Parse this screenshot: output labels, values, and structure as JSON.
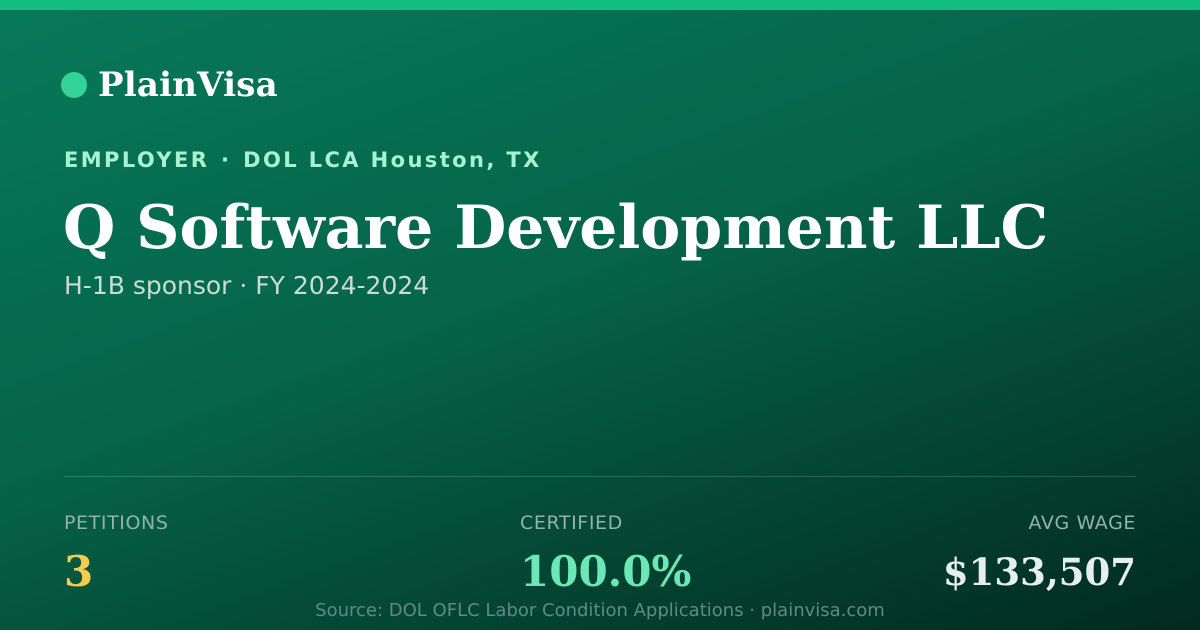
{
  "brand": {
    "name": "PlainVisa",
    "dot_color": "#34d399"
  },
  "header": {
    "eyebrow_category": "EMPLOYER",
    "eyebrow_separator": "·",
    "eyebrow_source": "DOL LCA Houston, TX",
    "title": "Q Software Development LLC",
    "subtitle": "H-1B sponsor · FY 2024-2024"
  },
  "stats": [
    {
      "label": "PETITIONS",
      "value": "3",
      "color": "#f5cc4f"
    },
    {
      "label": "CERTIFIED",
      "value": "100.0%",
      "color": "#6ee7b7"
    },
    {
      "label": "AVG WAGE",
      "value": "$133,507",
      "color": "#e6eef0"
    }
  ],
  "footer": {
    "text": "Source: DOL OFLC Labor Condition Applications · plainvisa.com"
  },
  "colors": {
    "accent_bar": "#13bf80",
    "background_top": "#07795a",
    "background_bottom": "#022a1f"
  }
}
